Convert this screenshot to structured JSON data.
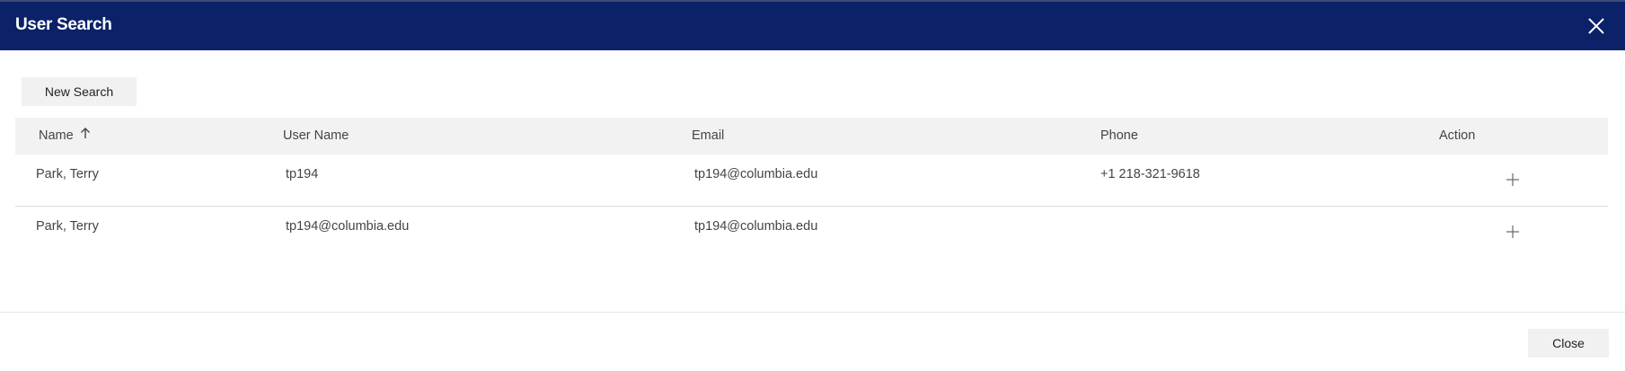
{
  "dialog": {
    "title": "User Search",
    "close_icon": "close-icon"
  },
  "toolbar": {
    "new_search_label": "New Search"
  },
  "table": {
    "columns": {
      "name": "Name",
      "username": "User Name",
      "email": "Email",
      "phone": "Phone",
      "action": "Action"
    },
    "sort": {
      "column": "Name",
      "direction": "ascending",
      "icon": "arrow-up-icon"
    },
    "rows": [
      {
        "name": "Park, Terry",
        "username": "tp194",
        "email": "tp194@columbia.edu",
        "phone": "+1 218-321-9618",
        "action_icon": "plus-icon"
      },
      {
        "name": "Park, Terry",
        "username": "tp194@columbia.edu",
        "email": "tp194@columbia.edu",
        "phone": "",
        "action_icon": "plus-icon"
      }
    ]
  },
  "footer": {
    "close_label": "Close"
  },
  "colors": {
    "titlebar": "#0b2268",
    "header_bg": "#f2f2f2",
    "button_bg": "#f1f1f1"
  }
}
